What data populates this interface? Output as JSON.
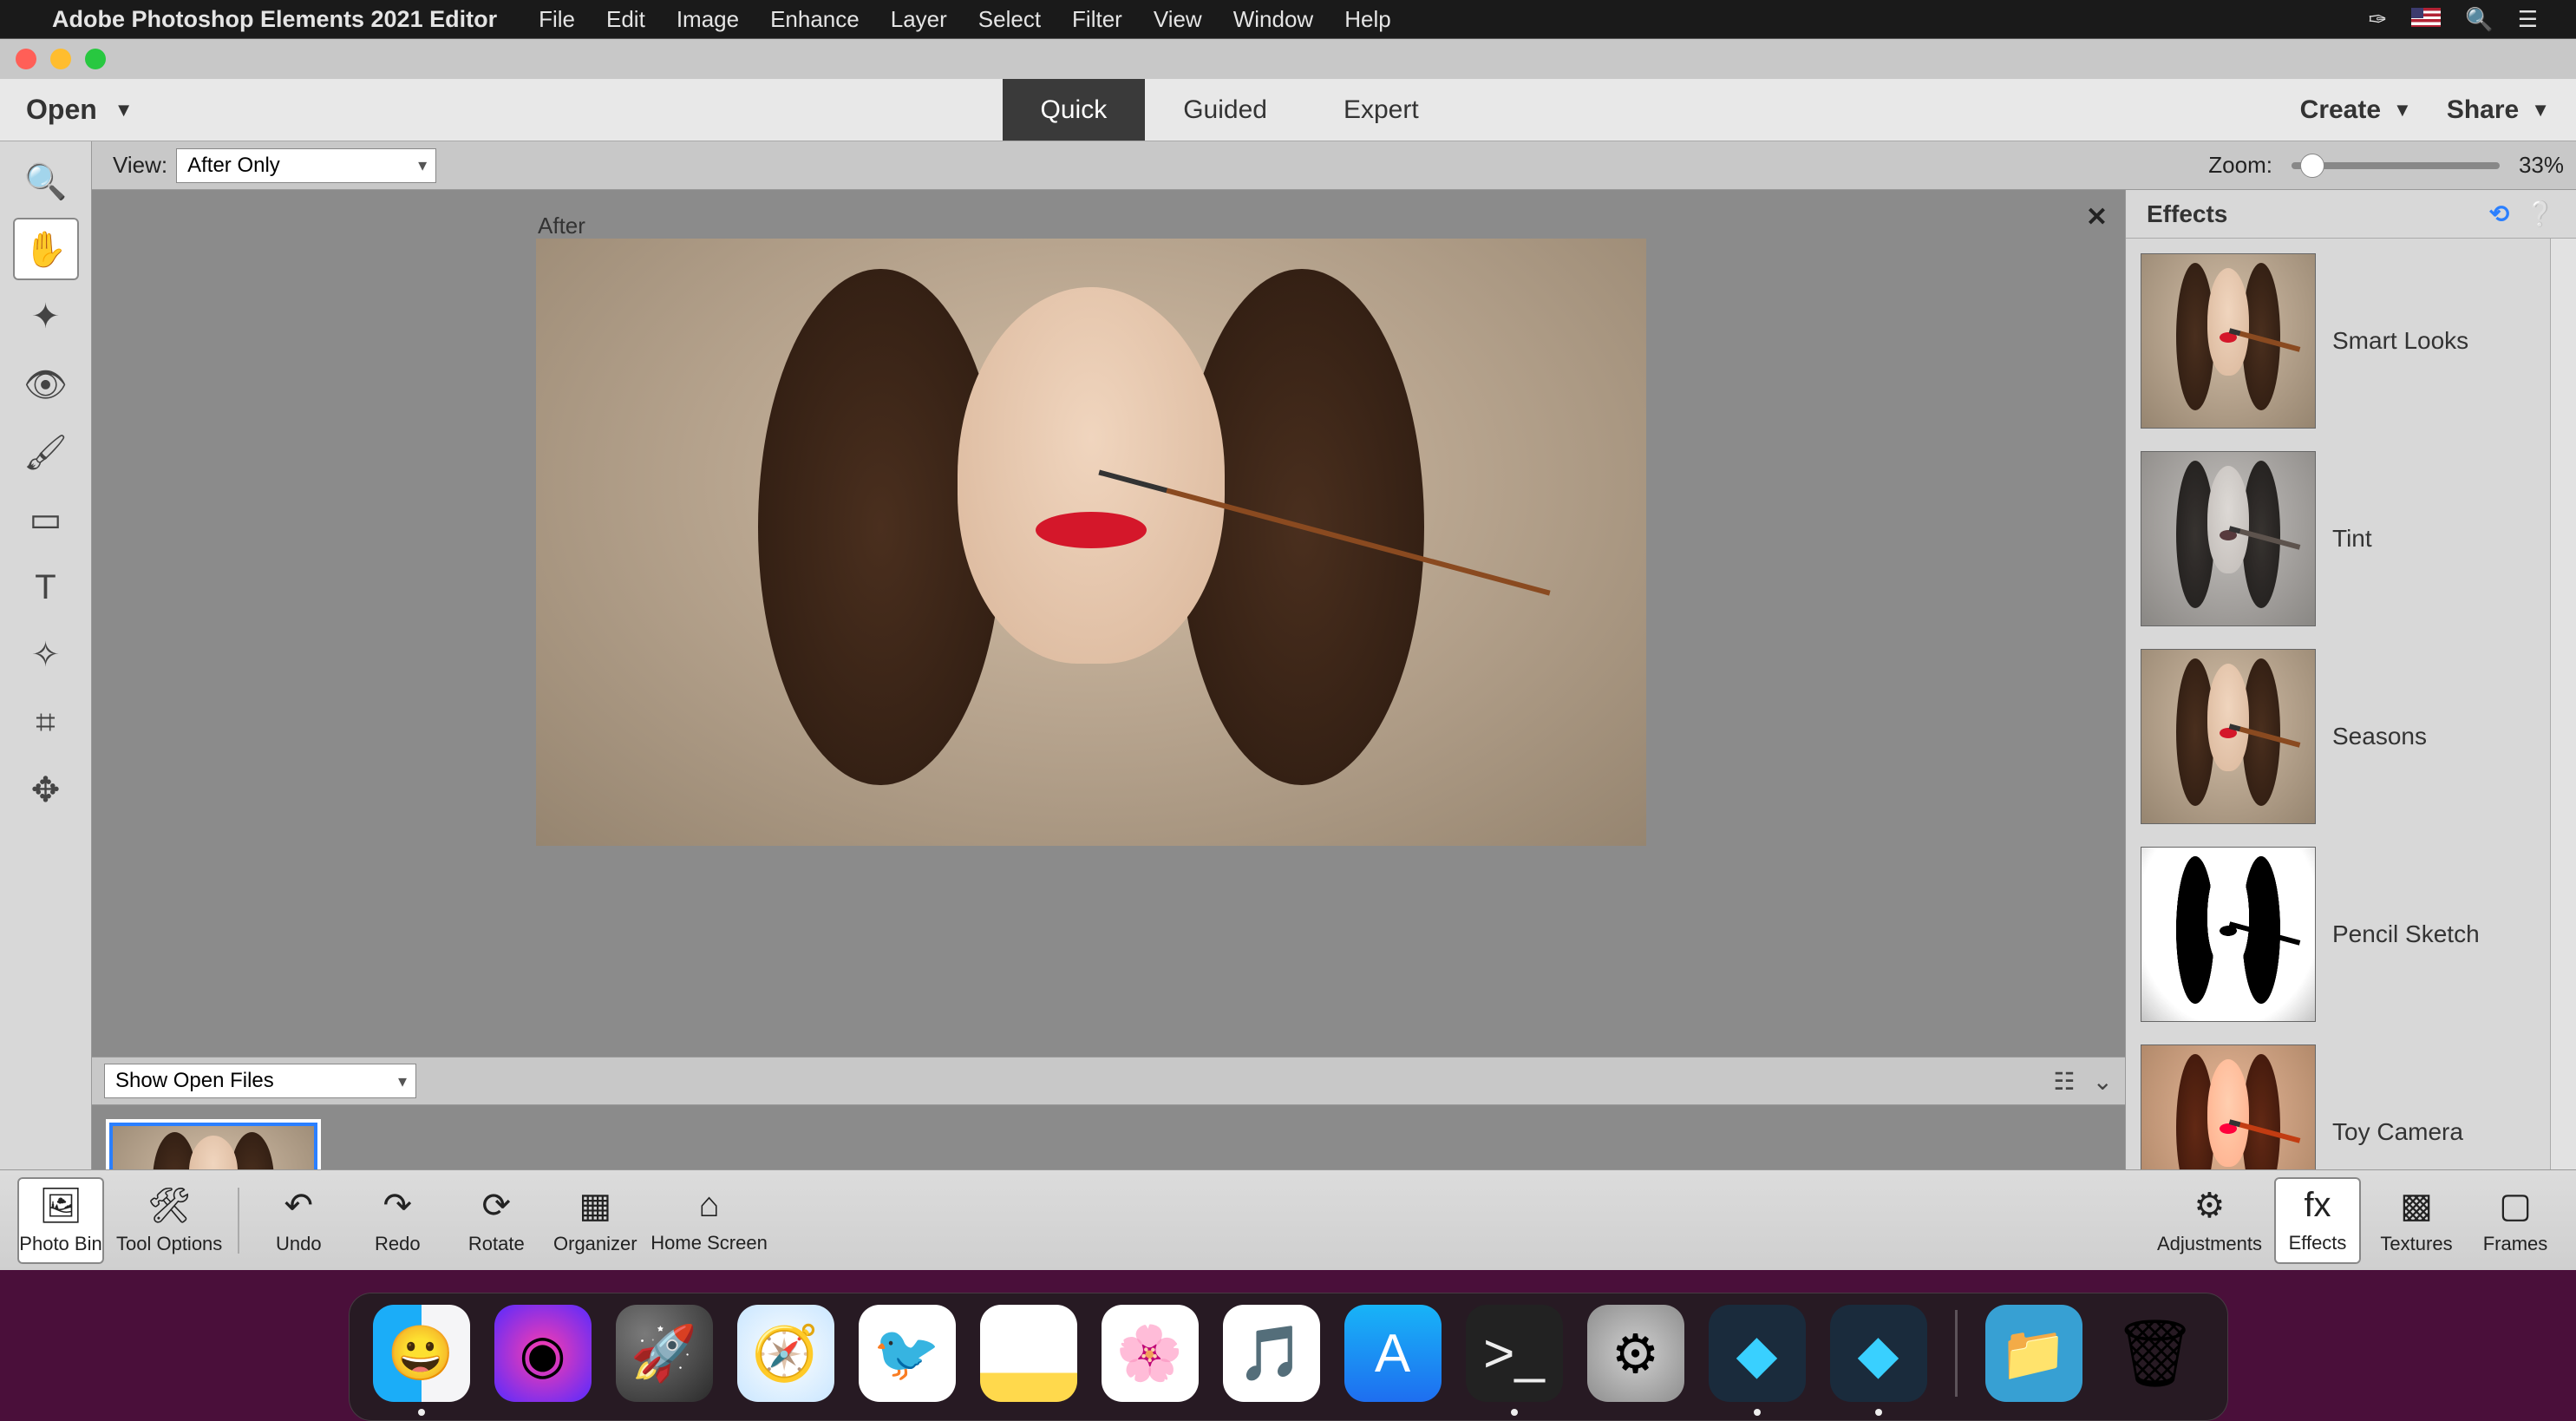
{
  "os": {
    "menubar": {
      "app_name": "Adobe Photoshop Elements 2021 Editor",
      "items": [
        "File",
        "Edit",
        "Image",
        "Enhance",
        "Layer",
        "Select",
        "Filter",
        "View",
        "Window",
        "Help"
      ]
    },
    "dock": [
      {
        "name": "Finder",
        "running": true
      },
      {
        "name": "Siri",
        "running": false
      },
      {
        "name": "Launchpad",
        "running": false
      },
      {
        "name": "Safari",
        "running": false
      },
      {
        "name": "Mail",
        "running": false
      },
      {
        "name": "Notes",
        "running": false
      },
      {
        "name": "Photos",
        "running": false
      },
      {
        "name": "Music",
        "running": false
      },
      {
        "name": "App Store",
        "running": false
      },
      {
        "name": "Terminal",
        "running": true
      },
      {
        "name": "System Preferences",
        "running": false
      },
      {
        "name": "PSE Organizer",
        "running": true
      },
      {
        "name": "PSE Editor",
        "running": true
      },
      {
        "name": "Downloads",
        "running": false
      },
      {
        "name": "Trash",
        "running": false
      }
    ]
  },
  "app": {
    "open_label": "Open",
    "tabs": {
      "quick": "Quick",
      "guided": "Guided",
      "expert": "Expert",
      "active": "quick"
    },
    "create_label": "Create",
    "share_label": "Share"
  },
  "subbar": {
    "view_label": "View:",
    "view_value": "After Only",
    "zoom_label": "Zoom:",
    "zoom_value": "33%",
    "zoom_slider_percent": 8
  },
  "tools": [
    {
      "name": "zoom-tool",
      "glyph": "🔍",
      "active": false
    },
    {
      "name": "hand-tool",
      "glyph": "✋",
      "active": true
    },
    {
      "name": "quick-select-tool",
      "glyph": "✦",
      "active": false
    },
    {
      "name": "eye-tool",
      "glyph": "👁",
      "active": false
    },
    {
      "name": "whiten-tool",
      "glyph": "🖌",
      "active": false
    },
    {
      "name": "straighten-tool",
      "glyph": "▭",
      "active": false
    },
    {
      "name": "type-tool",
      "glyph": "T",
      "active": false
    },
    {
      "name": "spot-heal-tool",
      "glyph": "✧",
      "active": false
    },
    {
      "name": "crop-tool",
      "glyph": "⌗",
      "active": false
    },
    {
      "name": "move-tool",
      "glyph": "✥",
      "active": false
    }
  ],
  "canvas": {
    "label": "After"
  },
  "photobin": {
    "dropdown_value": "Show Open Files",
    "thumbs": 1
  },
  "effects_panel": {
    "title": "Effects",
    "items": [
      {
        "name": "Smart Looks",
        "style": "normal"
      },
      {
        "name": "Tint",
        "style": "tint"
      },
      {
        "name": "Seasons",
        "style": "normal"
      },
      {
        "name": "Pencil Sketch",
        "style": "sketch"
      },
      {
        "name": "Toy Camera",
        "style": "toy"
      }
    ]
  },
  "bottom_bar": {
    "left": [
      {
        "name": "Photo Bin",
        "icon": "🖼",
        "active": true
      },
      {
        "name": "Tool Options",
        "icon": "🛠",
        "active": false
      }
    ],
    "mid": [
      {
        "name": "Undo",
        "icon": "↶"
      },
      {
        "name": "Redo",
        "icon": "↷"
      },
      {
        "name": "Rotate",
        "icon": "⟳"
      },
      {
        "name": "Organizer",
        "icon": "▦"
      },
      {
        "name": "Home Screen",
        "icon": "⌂"
      }
    ],
    "right": [
      {
        "name": "Adjustments",
        "icon": "⚙"
      },
      {
        "name": "Effects",
        "icon": "fx",
        "active": true
      },
      {
        "name": "Textures",
        "icon": "▩"
      },
      {
        "name": "Frames",
        "icon": "▢"
      }
    ]
  }
}
